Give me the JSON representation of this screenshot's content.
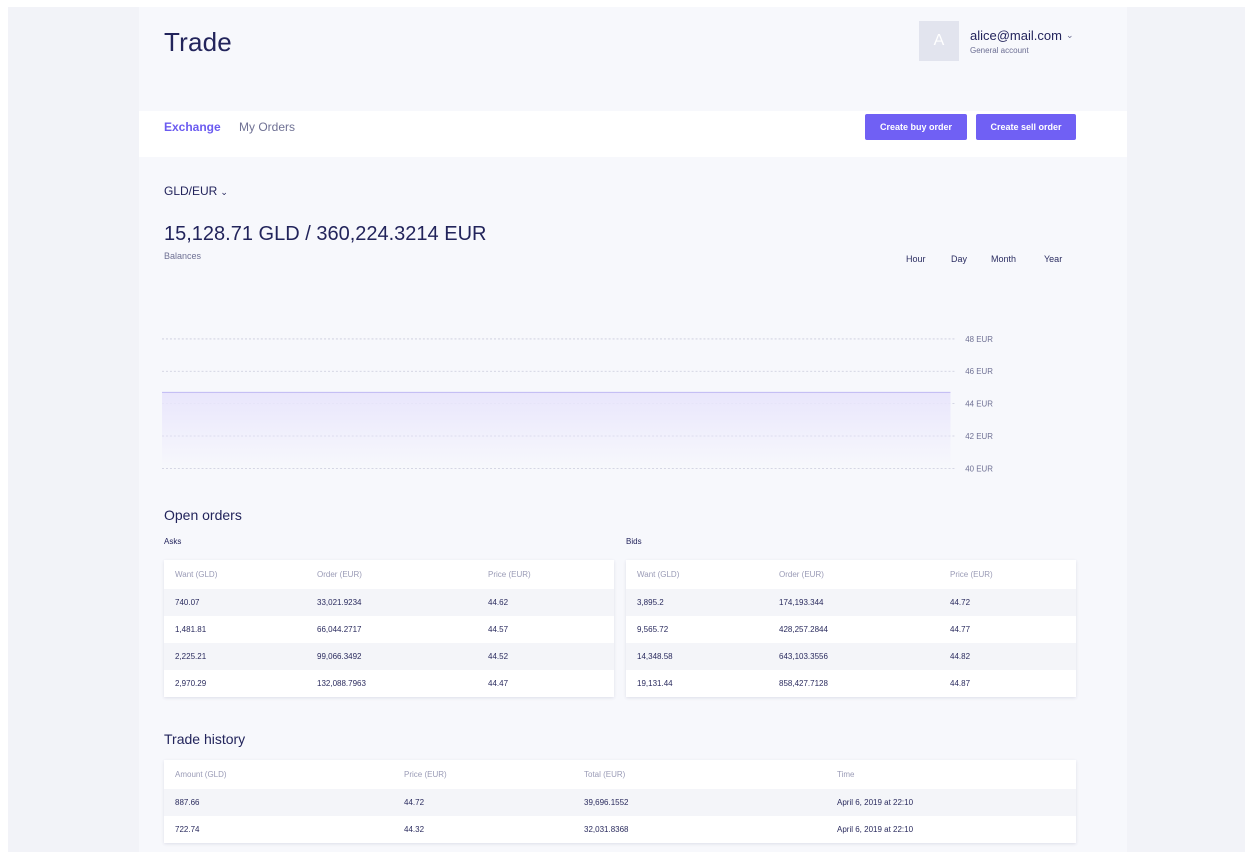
{
  "header": {
    "title": "Trade",
    "avatar_initial": "A",
    "user_email": "alice@mail.com",
    "user_account": "General account"
  },
  "nav": {
    "tabs": [
      {
        "label": "Exchange",
        "active": true
      },
      {
        "label": "My Orders",
        "active": false
      }
    ],
    "create_buy_label": "Create buy order",
    "create_sell_label": "Create sell order"
  },
  "market": {
    "pair": "GLD/EUR",
    "balance": "15,128.71 GLD / 360,224.3214 EUR",
    "balance_label": "Balances",
    "ranges": [
      "Hour",
      "Day",
      "Month",
      "Year"
    ]
  },
  "chart_data": {
    "type": "area",
    "title": "",
    "xlabel": "",
    "ylabel": "",
    "y_ticks": [
      "48 EUR",
      "46 EUR",
      "44 EUR",
      "42 EUR",
      "40 EUR"
    ],
    "ylim": [
      40,
      48
    ],
    "x": [
      0,
      1
    ],
    "series": [
      {
        "values": [
          44.7,
          44.7
        ]
      }
    ],
    "grid": true
  },
  "open_orders": {
    "title": "Open orders",
    "asks": {
      "label": "Asks",
      "headers": [
        "Want (GLD)",
        "Order (EUR)",
        "Price (EUR)"
      ],
      "rows": [
        [
          "740.07",
          "33,021.9234",
          "44.62"
        ],
        [
          "1,481.81",
          "66,044.2717",
          "44.57"
        ],
        [
          "2,225.21",
          "99,066.3492",
          "44.52"
        ],
        [
          "2,970.29",
          "132,088.7963",
          "44.47"
        ]
      ]
    },
    "bids": {
      "label": "Bids",
      "headers": [
        "Want (GLD)",
        "Order (EUR)",
        "Price (EUR)"
      ],
      "rows": [
        [
          "3,895.2",
          "174,193.344",
          "44.72"
        ],
        [
          "9,565.72",
          "428,257.2844",
          "44.77"
        ],
        [
          "14,348.58",
          "643,103.3556",
          "44.82"
        ],
        [
          "19,131.44",
          "858,427.7128",
          "44.87"
        ]
      ]
    }
  },
  "trade_history": {
    "title": "Trade history",
    "headers": [
      "Amount (GLD)",
      "Price (EUR)",
      "Total (EUR)",
      "Time"
    ],
    "rows": [
      [
        "887.66",
        "44.72",
        "39,696.1552",
        "April 6, 2019 at 22:10"
      ],
      [
        "722.74",
        "44.32",
        "32,031.8368",
        "April 6, 2019 at 22:10"
      ]
    ]
  },
  "colors": {
    "accent": "#7060f4",
    "title": "#22245b",
    "muted": "#6f7194",
    "chart_line": "#b9b2f2",
    "chart_fill": "#e9e6fc"
  }
}
